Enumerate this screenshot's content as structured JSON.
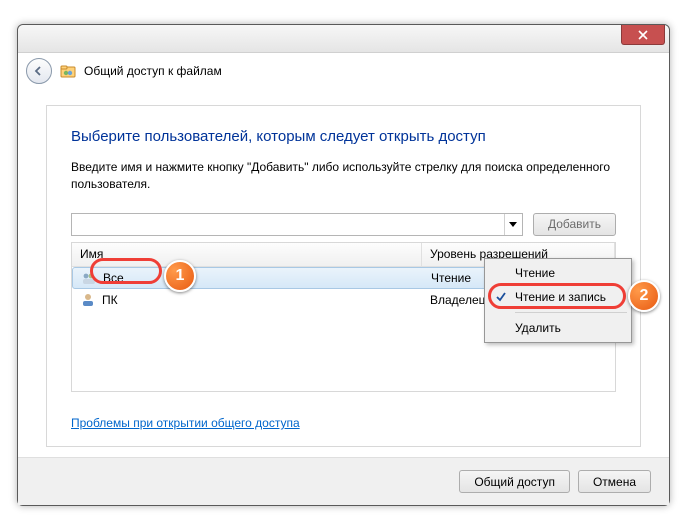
{
  "window": {
    "title": "Общий доступ к файлам"
  },
  "heading": "Выберите пользователей, которым следует открыть доступ",
  "description": "Введите имя и нажмите кнопку \"Добавить\" либо используйте стрелку для поиска определенного пользователя.",
  "buttons": {
    "add": "Добавить",
    "share": "Общий доступ",
    "cancel": "Отмена"
  },
  "columns": {
    "name": "Имя",
    "permission": "Уровень разрешений"
  },
  "rows": [
    {
      "name": "Все",
      "permission": "Чтение",
      "selected": true
    },
    {
      "name": "ПК",
      "permission": "Владелец",
      "selected": false
    }
  ],
  "menu": {
    "read": "Чтение",
    "readwrite": "Чтение и запись",
    "remove": "Удалить",
    "checked": "readwrite"
  },
  "link": "Проблемы при открытии общего доступа",
  "callouts": {
    "1": "1",
    "2": "2"
  }
}
